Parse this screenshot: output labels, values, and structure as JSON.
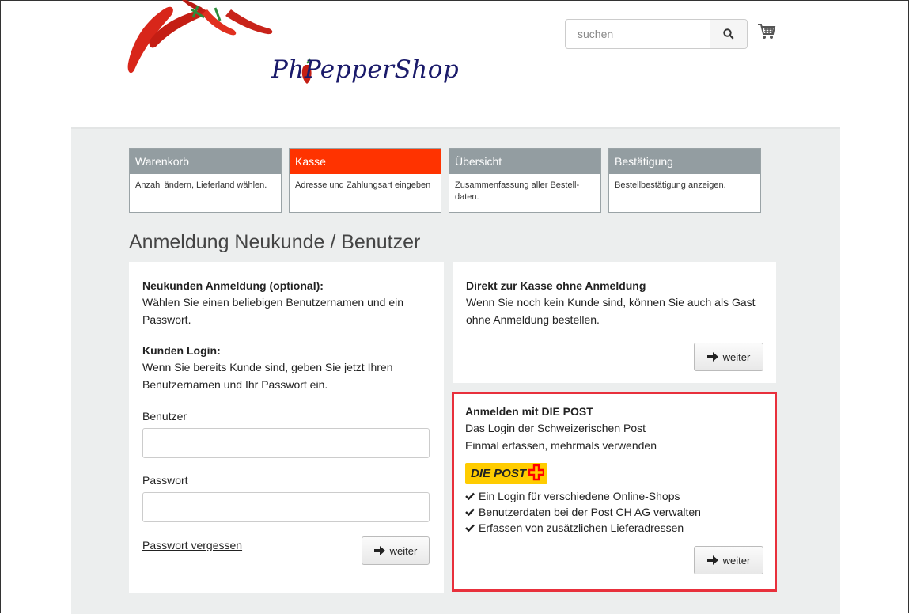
{
  "header": {
    "logo_text": "PhPepperShop",
    "search_placeholder": "suchen"
  },
  "steps": [
    {
      "label": "Warenkorb",
      "desc": "Anzahl ändern, Lieferland wählen.",
      "active": false
    },
    {
      "label": "Kasse",
      "desc": "Adresse und Zahlungsart eingeben",
      "active": true
    },
    {
      "label": "Übersicht",
      "desc": "Zusammenfassung aller Bestell-daten.",
      "active": false
    },
    {
      "label": "Bestätigung",
      "desc": "Bestellbestätigung anzeigen.",
      "active": false
    }
  ],
  "page_title": "Anmeldung Neukunde / Benutzer",
  "login_box": {
    "new_heading": "Neukunden Anmeldung (optional):",
    "new_text": "Wählen Sie einen beliebigen Benutzernamen und ein Passwort.",
    "login_heading": "Kunden Login:",
    "login_text": "Wenn Sie bereits Kunde sind, geben Sie jetzt Ihren Benutzernamen und Ihr Passwort ein.",
    "user_label": "Benutzer",
    "user_value": "",
    "password_label": "Passwort",
    "password_value": "",
    "forgot_link": "Passwort vergessen",
    "submit_label": "weiter"
  },
  "guest_box": {
    "heading": "Direkt zur Kasse ohne Anmeldung",
    "text": "Wenn Sie noch kein Kunde sind, können Sie auch als Gast ohne Anmeldung bestellen.",
    "submit_label": "weiter"
  },
  "post_box": {
    "heading": "Anmelden mit DIE POST",
    "line1": "Das Login der Schweizerischen Post",
    "line2": "Einmal erfassen, mehrmals verwenden",
    "badge_text": "DIE POST",
    "features": [
      "Ein Login für verschiedene Online-Shops",
      "Benutzerdaten bei der Post CH AG verwalten",
      "Erfassen von zusätzlichen Lieferadressen"
    ],
    "submit_label": "weiter",
    "border_color": "#e8303c"
  },
  "colors": {
    "active_step": "#ff3300",
    "inactive_step": "#939da1",
    "post_yellow": "#ffcc00",
    "post_red": "#ff0000"
  }
}
